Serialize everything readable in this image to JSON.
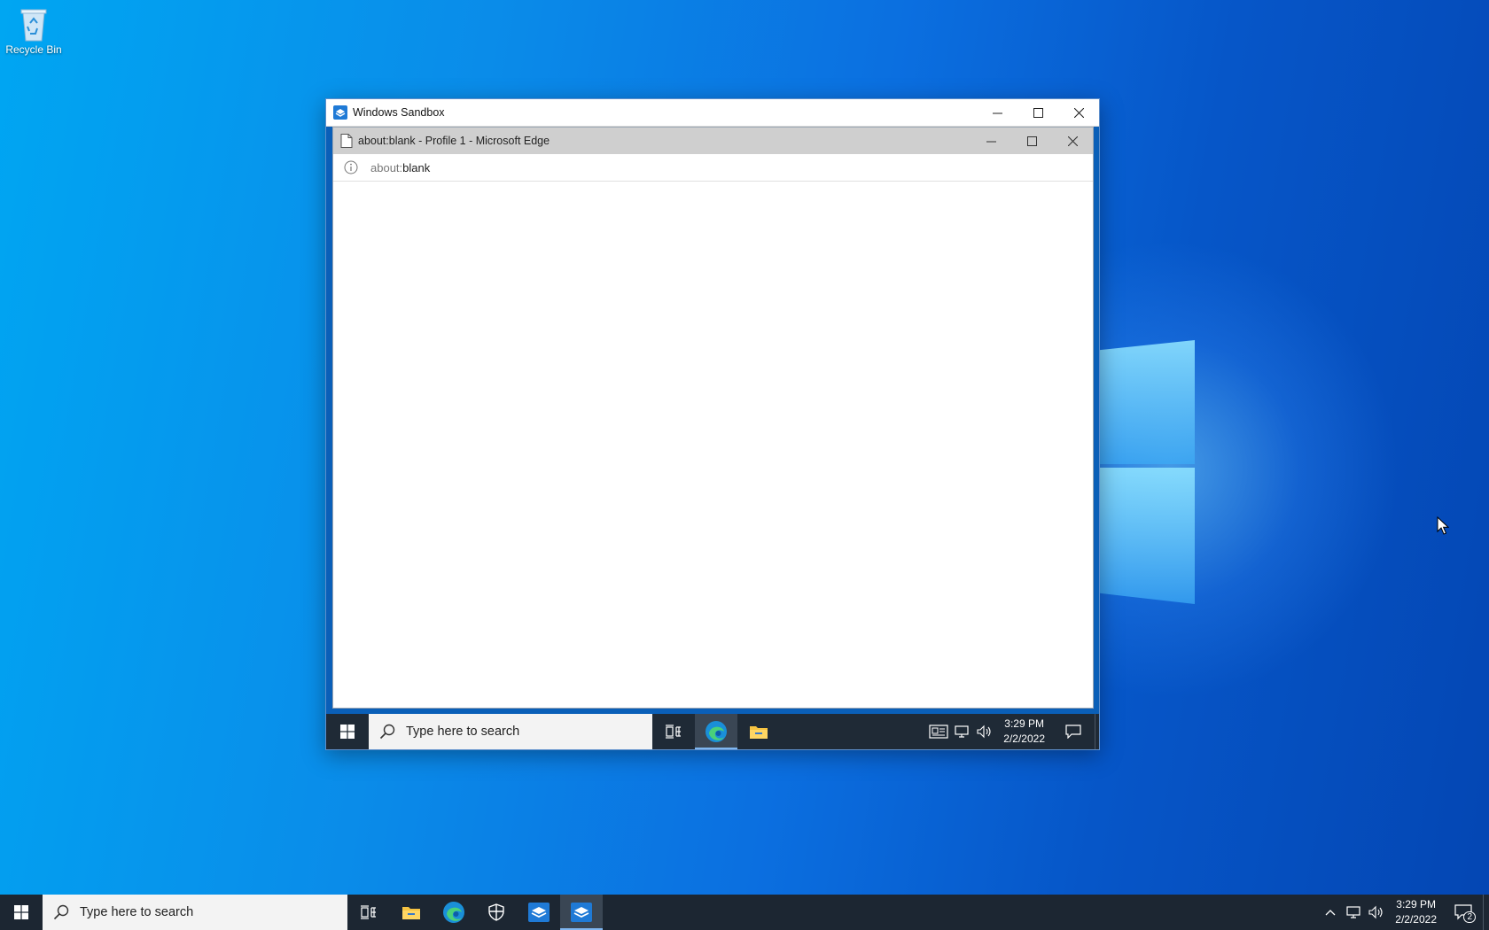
{
  "desktop": {
    "icons": [
      {
        "label": "Recycle Bin"
      }
    ]
  },
  "sandbox_window": {
    "title": "Windows Sandbox",
    "edge_window": {
      "title": "about:blank - Profile 1 - Microsoft Edge",
      "address_scheme": "about:",
      "address_rest": "blank"
    },
    "taskbar": {
      "search_placeholder": "Type here to search",
      "time": "3:29 PM",
      "date": "2/2/2022"
    }
  },
  "taskbar": {
    "search_placeholder": "Type here to search",
    "time": "3:29 PM",
    "date": "2/2/2022",
    "notification_count": "2"
  },
  "colors": {
    "taskbar": "#1c2632",
    "accent": "#0a6be0",
    "sandbox_border": "#0a5fb8"
  }
}
